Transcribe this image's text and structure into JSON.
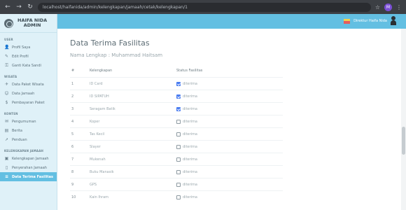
{
  "browser": {
    "url": "localhost/haifanida/admin/kelengkapan/jamaah/cetak/kelengkapan/1",
    "avatar_letter": "M"
  },
  "sidebar": {
    "brand_line1": "HAIFA NIDA",
    "brand_line2": "ADMIN",
    "sections": [
      {
        "title": "USER",
        "items": [
          "Profil Saya",
          "Edit Profil",
          "Ganti Kata Sandi"
        ]
      },
      {
        "title": "WISATA",
        "items": [
          "Data Paket Wisata",
          "Data Jamaah",
          "Pembayaran Paket"
        ]
      },
      {
        "title": "KONTEN",
        "items": [
          "Pengumuman",
          "Berita",
          "Penduan"
        ]
      },
      {
        "title": "KELENGKAPAN JAMAAH",
        "items": [
          "Kelengkapan Jamaah",
          "Penyerahan Jamaah",
          "Data Terima Fasilitas"
        ]
      }
    ]
  },
  "topbar": {
    "user_name": "Direktur Haifa Nida"
  },
  "main": {
    "title": "Data Terima Fasilitas",
    "name_line": "Nama Lengkap : Muhammad Haitsam",
    "headers": [
      "#",
      "Kelengkapan",
      "Status Fasilitas"
    ],
    "rows": [
      {
        "no": "1",
        "item": "ID Card",
        "status": "diterima",
        "checked": true
      },
      {
        "no": "2",
        "item": "ID SIPATUH",
        "status": "diterima",
        "checked": true
      },
      {
        "no": "3",
        "item": "Seragam Batik",
        "status": "diterima",
        "checked": true
      },
      {
        "no": "4",
        "item": "Koper",
        "status": "diterima",
        "checked": false
      },
      {
        "no": "5",
        "item": "Tas Kecil",
        "status": "diterima",
        "checked": false
      },
      {
        "no": "6",
        "item": "Slayer",
        "status": "diterima",
        "checked": false
      },
      {
        "no": "7",
        "item": "Mukenah",
        "status": "diterima",
        "checked": false
      },
      {
        "no": "8",
        "item": "Buku Manasik",
        "status": "diterima",
        "checked": false
      },
      {
        "no": "9",
        "item": "GPS",
        "status": "diterima",
        "checked": false
      },
      {
        "no": "10",
        "item": "Kain Ihram",
        "status": "diterima",
        "checked": false
      }
    ]
  },
  "colors": {
    "accent": "#63bfe2",
    "sidebar_bg": "#dff1f8",
    "checkbox": "#4b7df0"
  }
}
